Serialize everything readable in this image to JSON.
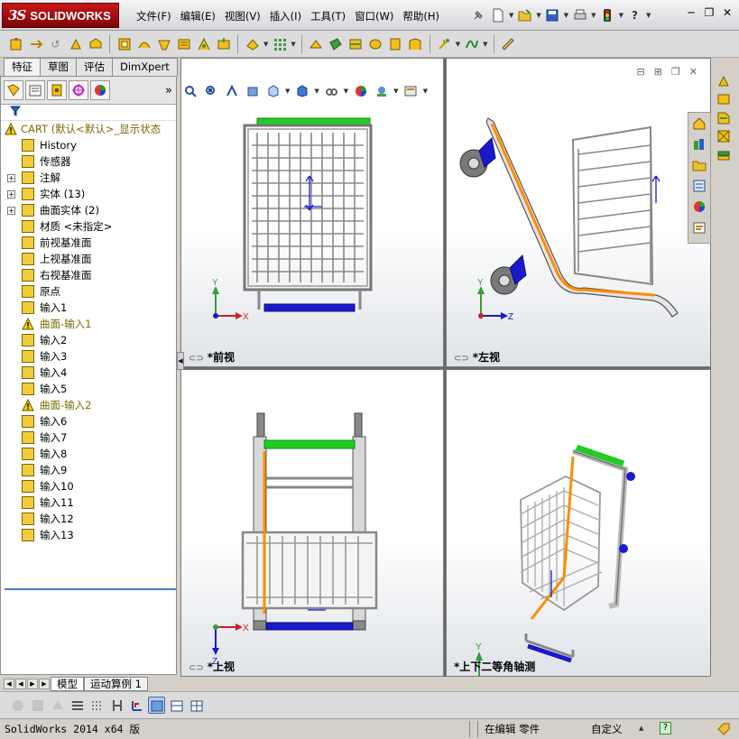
{
  "app": {
    "brand_prefix": "3S",
    "brand": "SOLIDWORKS"
  },
  "menu": [
    "文件(F)",
    "编辑(E)",
    "视图(V)",
    "插入(I)",
    "工具(T)",
    "窗口(W)",
    "帮助(H)"
  ],
  "feature_manager": {
    "tabs": [
      "特征",
      "草图",
      "评估",
      "DimXpert"
    ],
    "tree": [
      {
        "label": "CART  (默认<默认>_显示状态",
        "warn": true,
        "level": 0
      },
      {
        "label": "History",
        "level": 1
      },
      {
        "label": "传感器",
        "level": 1
      },
      {
        "label": "注解",
        "level": 1,
        "expand": "+"
      },
      {
        "label": "实体 (13)",
        "level": 1,
        "expand": "+"
      },
      {
        "label": "曲面实体 (2)",
        "level": 1,
        "expand": "+"
      },
      {
        "label": "材质 <未指定>",
        "level": 1
      },
      {
        "label": "前视基准面",
        "level": 1
      },
      {
        "label": "上视基准面",
        "level": 1
      },
      {
        "label": "右视基准面",
        "level": 1
      },
      {
        "label": "原点",
        "level": 1
      },
      {
        "label": "输入1",
        "level": 1
      },
      {
        "label": "曲面-输入1",
        "level": 1,
        "warn": true
      },
      {
        "label": "输入2",
        "level": 1
      },
      {
        "label": "输入3",
        "level": 1
      },
      {
        "label": "输入4",
        "level": 1
      },
      {
        "label": "输入5",
        "level": 1
      },
      {
        "label": "曲面-输入2",
        "level": 1,
        "warn": true
      },
      {
        "label": "输入6",
        "level": 1
      },
      {
        "label": "输入7",
        "level": 1
      },
      {
        "label": "输入8",
        "level": 1
      },
      {
        "label": "输入9",
        "level": 1
      },
      {
        "label": "输入10",
        "level": 1
      },
      {
        "label": "输入11",
        "level": 1
      },
      {
        "label": "输入12",
        "level": 1
      },
      {
        "label": "输入13",
        "level": 1
      }
    ],
    "bottom_tabs": [
      "模型",
      "运动算例 1"
    ]
  },
  "viewports": {
    "front": {
      "label": "*前视"
    },
    "left": {
      "label": "*左视"
    },
    "top": {
      "label": "*上视"
    },
    "iso": {
      "label": "*上下二等角轴测"
    }
  },
  "axes": {
    "x": "X",
    "y": "Y",
    "z": "Z"
  },
  "status": {
    "app_version": "SolidWorks 2014 x64 版",
    "mode": "在编辑 零件",
    "units": "自定义",
    "help": "?"
  },
  "colors": {
    "accent_orange": "#ff8c00",
    "handle_green": "#22cc22",
    "bar_blue": "#1a1acc",
    "brand_red": "#b01010"
  }
}
